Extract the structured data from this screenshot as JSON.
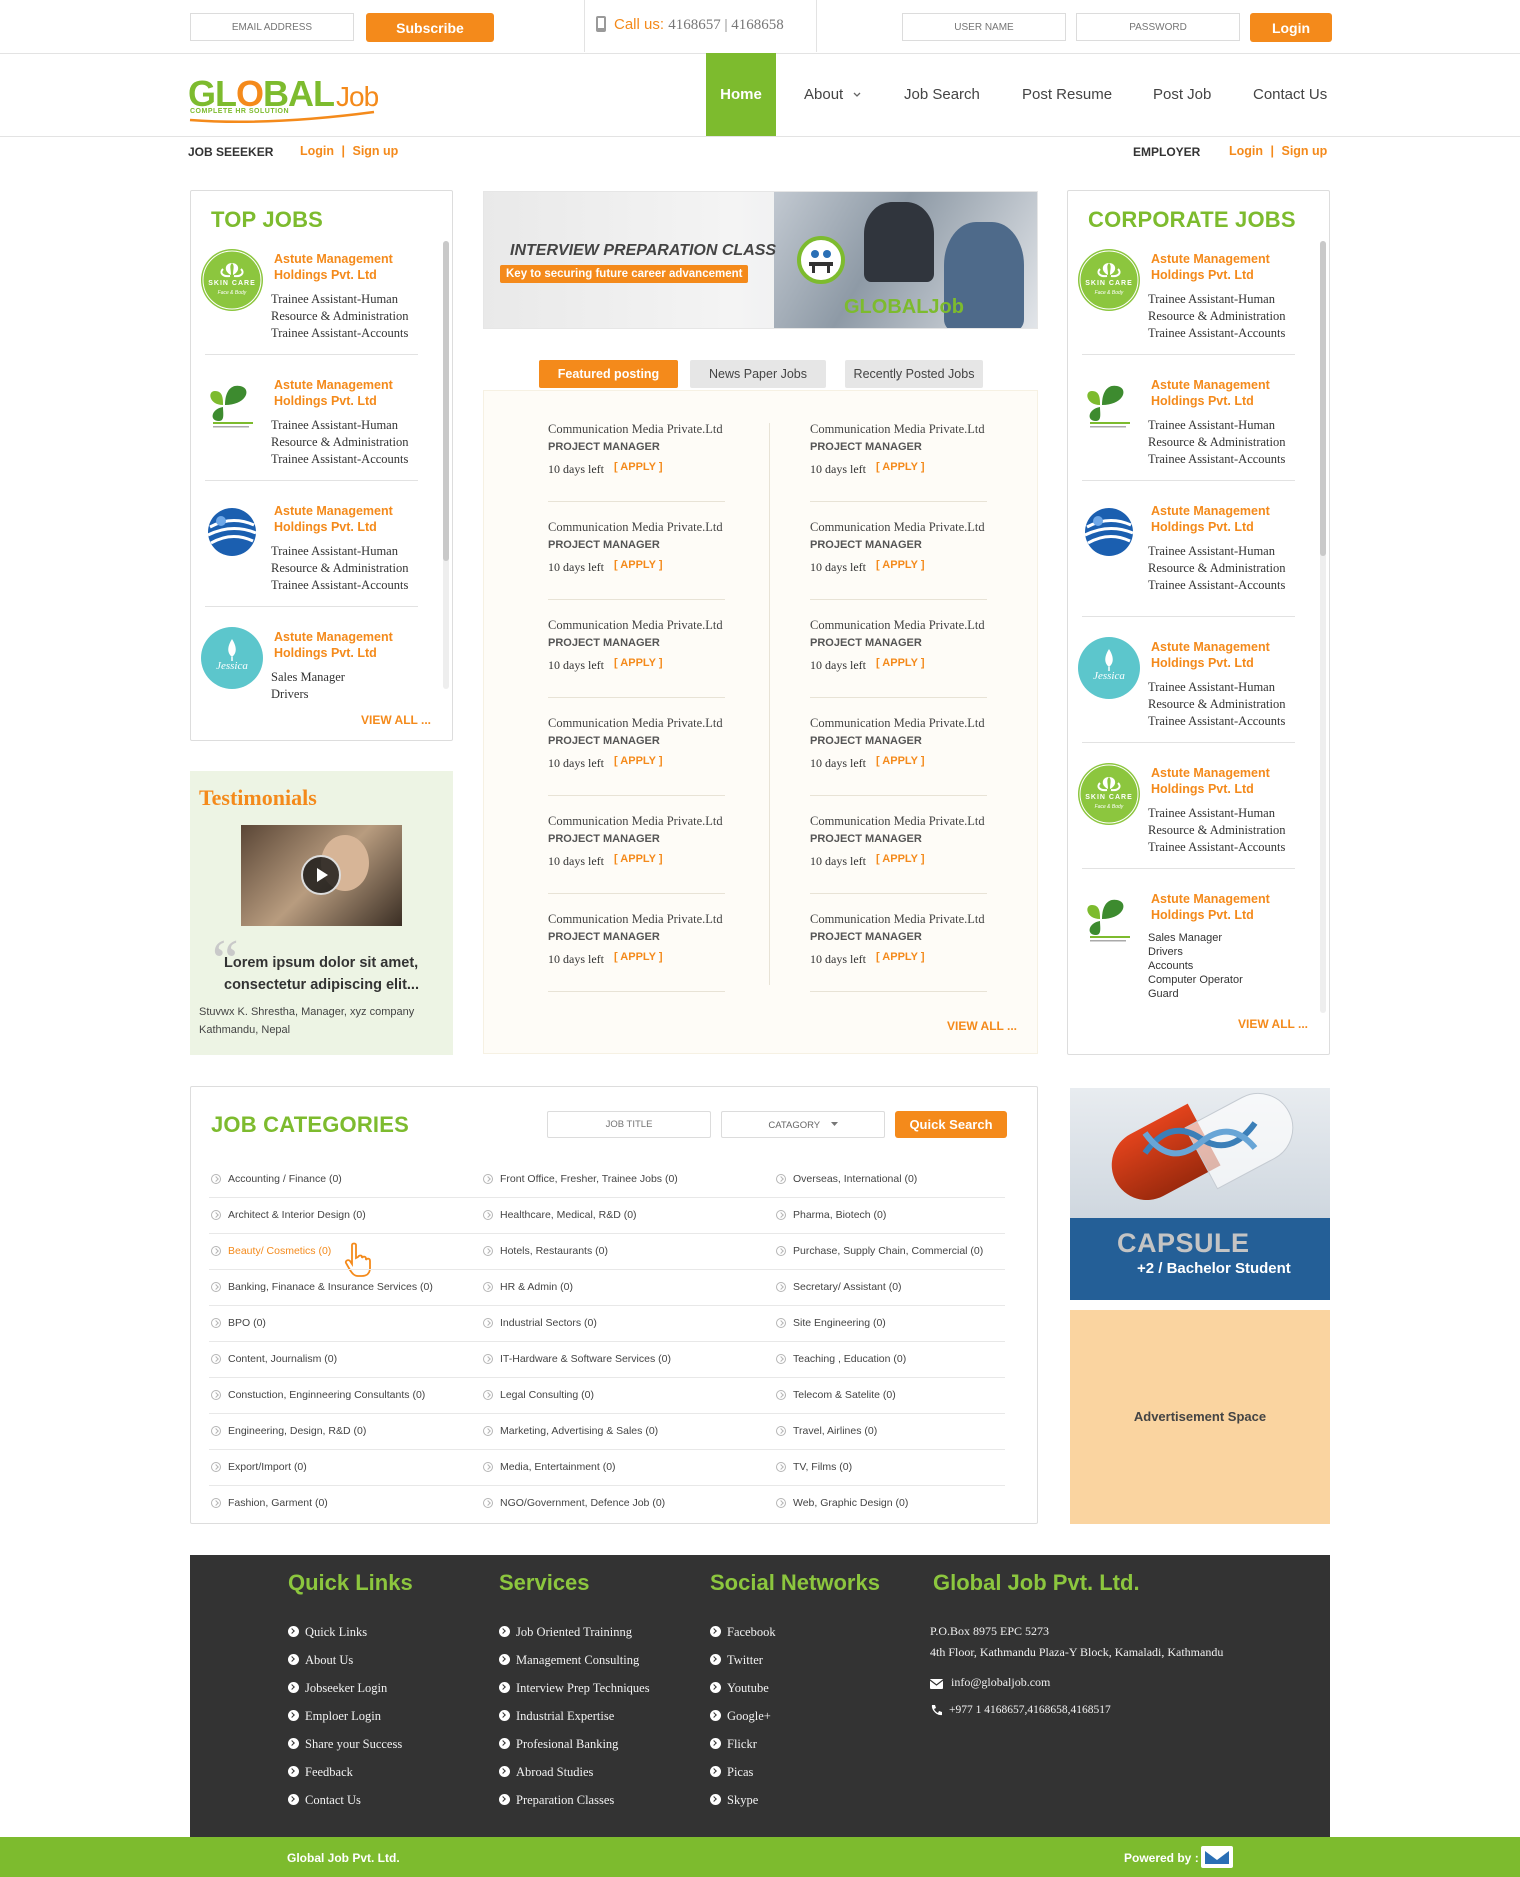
{
  "topbar": {
    "email_placeholder": "EMAIL ADDRESS",
    "subscribe_label": "Subscribe",
    "call_label": "Call us:",
    "call_numbers": "4168657 | 4168658",
    "username_placeholder": "USER NAME",
    "password_placeholder": "PASSWORD",
    "login_label": "Login"
  },
  "brand": {
    "logo_main": "GL",
    "logo_o": "O",
    "logo_rest": "BAL",
    "logo_job": "Job",
    "tagline": "COMPLETE HR SOLUTION"
  },
  "nav": {
    "home": "Home",
    "about": "About",
    "job_search": "Job Search",
    "post_resume": "Post Resume",
    "post_job": "Post Job",
    "contact_us": "Contact Us"
  },
  "subbar": {
    "seeker_label": "JOB SEEEKER",
    "seeker_login": "Login",
    "seeker_sep": "|",
    "seeker_signup": "Sign up",
    "employer_label": "EMPLOYER",
    "employer_login": "Login",
    "employer_sep": "|",
    "employer_signup": "Sign up"
  },
  "top_jobs": {
    "title": "TOP JOBS",
    "view_all": "VIEW ALL ...",
    "items": [
      {
        "company": "Astute Management Holdings Pvt. Ltd",
        "logo": "skincare-logo",
        "logo_text": "SKIN CARE",
        "logo_sub": "Face & Body",
        "lines": [
          "Trainee Assistant-Human Resource & Administration",
          "Trainee Assistant-Accounts"
        ]
      },
      {
        "company": "Astute Management Holdings Pvt. Ltd",
        "logo": "leaf-logo",
        "lines": [
          "Trainee Assistant-Human Resource & Administration",
          "Trainee Assistant-Accounts"
        ]
      },
      {
        "company": "Astute Management Holdings Pvt. Ltd",
        "logo": "globe-logo",
        "lines": [
          "Trainee Assistant-Human Resource & Administration",
          "Trainee Assistant-Accounts"
        ]
      },
      {
        "company": "Astute Management Holdings Pvt. Ltd",
        "logo": "jessica-logo",
        "logo_text": "Jessica",
        "lines": [
          "Sales Manager",
          "Drivers"
        ]
      }
    ]
  },
  "banner": {
    "title": "INTERVIEW PREPARATION CLASS",
    "subtitle": "Key to securing future career advancement",
    "logo_text": "GLOBALJob"
  },
  "tabs": {
    "featured": "Featured posting",
    "newspaper": "News Paper Jobs",
    "recent": "Recently Posted Jobs"
  },
  "featured": {
    "view_all": "VIEW ALL ...",
    "items": [
      {
        "company": "Communication Media Private.Ltd",
        "position": "PROJECT MANAGER",
        "days": "10 days left",
        "apply": "[ APPLY ]"
      },
      {
        "company": "Communication Media Private.Ltd",
        "position": "PROJECT MANAGER",
        "days": "10 days left",
        "apply": "[ APPLY ]"
      },
      {
        "company": "Communication Media Private.Ltd",
        "position": "PROJECT MANAGER",
        "days": "10 days left",
        "apply": "[ APPLY ]"
      },
      {
        "company": "Communication Media Private.Ltd",
        "position": "PROJECT MANAGER",
        "days": "10 days left",
        "apply": "[ APPLY ]"
      },
      {
        "company": "Communication Media Private.Ltd",
        "position": "PROJECT MANAGER",
        "days": "10 days left",
        "apply": "[ APPLY ]"
      },
      {
        "company": "Communication Media Private.Ltd",
        "position": "PROJECT MANAGER",
        "days": "10 days left",
        "apply": "[ APPLY ]"
      },
      {
        "company": "Communication Media Private.Ltd",
        "position": "PROJECT MANAGER",
        "days": "10 days left",
        "apply": "[ APPLY ]"
      },
      {
        "company": "Communication Media Private.Ltd",
        "position": "PROJECT MANAGER",
        "days": "10 days left",
        "apply": "[ APPLY ]"
      },
      {
        "company": "Communication Media Private.Ltd",
        "position": "PROJECT MANAGER",
        "days": "10 days left",
        "apply": "[ APPLY ]"
      },
      {
        "company": "Communication Media Private.Ltd",
        "position": "PROJECT MANAGER",
        "days": "10 days left",
        "apply": "[ APPLY ]"
      },
      {
        "company": "Communication Media Private.Ltd",
        "position": "PROJECT MANAGER",
        "days": "10 days left",
        "apply": "[ APPLY ]"
      },
      {
        "company": "Communication Media Private.Ltd",
        "position": "PROJECT MANAGER",
        "days": "10 days left",
        "apply": "[ APPLY ]"
      }
    ]
  },
  "corporate_jobs": {
    "title": "CORPORATE JOBS",
    "view_all": "VIEW ALL ...",
    "items": [
      {
        "company": "Astute Management Holdings Pvt. Ltd",
        "logo": "skincare-logo",
        "logo_text": "SKIN CARE",
        "logo_sub": "Face & Body",
        "lines": [
          "Trainee Assistant-Human Resource & Administration",
          "Trainee Assistant-Accounts"
        ]
      },
      {
        "company": "Astute Management Holdings Pvt. Ltd",
        "logo": "leaf-logo",
        "lines": [
          "Trainee Assistant-Human Resource & Administration",
          "Trainee Assistant-Accounts"
        ]
      },
      {
        "company": "Astute Management Holdings Pvt. Ltd",
        "logo": "globe-logo",
        "lines": [
          "Trainee Assistant-Human Resource & Administration",
          "Trainee Assistant-Accounts"
        ]
      },
      {
        "company": "Astute Management Holdings Pvt. Ltd",
        "logo": "jessica-logo",
        "logo_text": "Jessica",
        "lines": [
          "Trainee Assistant-Human Resource & Administration",
          "Trainee Assistant-Accounts"
        ]
      },
      {
        "company": "Astute Management Holdings Pvt. Ltd",
        "logo": "skincare-logo",
        "logo_text": "SKIN CARE",
        "logo_sub": "Face & Body",
        "lines": [
          "Trainee Assistant-Human Resource & Administration",
          "Trainee Assistant-Accounts"
        ]
      },
      {
        "company": "Astute Management Holdings Pvt. Ltd",
        "logo": "leaf-logo",
        "lines": [
          "Sales Manager",
          "Drivers",
          "Accounts",
          "Computer Operator",
          "Guard"
        ]
      }
    ]
  },
  "testimonials": {
    "title": "Testimonials",
    "quote": "Lorem ipsum dolor sit amet, consectetur adipiscing elit...",
    "author": "Stuvwx K. Shrestha, Manager, xyz company",
    "location": "Kathmandu, Nepal"
  },
  "categories": {
    "title": "JOB CATEGORIES",
    "job_title_placeholder": "JOB TITLE",
    "category_label": "CATAGORY",
    "quick_search": "Quick Search",
    "columns": [
      [
        "Accounting / Finance (0)",
        "Architect & Interior Design (0)",
        "Beauty/ Cosmetics (0)",
        "Banking, Finanace & Insurance Services (0)",
        "BPO (0)",
        "Content, Journalism (0)",
        "Constuction, Enginneering Consultants (0)",
        "Engineering, Design, R&D (0)",
        "Export/Import (0)",
        "Fashion, Garment (0)"
      ],
      [
        "Front Office, Fresher, Trainee Jobs (0)",
        "Healthcare, Medical, R&D (0)",
        "Hotels, Restaurants (0)",
        "HR & Admin (0)",
        "Industrial Sectors (0)",
        "IT-Hardware & Software Services (0)",
        "Legal Consulting (0)",
        "Marketing, Advertising & Sales (0)",
        "Media, Entertainment (0)",
        "NGO/Government, Defence Job (0)"
      ],
      [
        "Overseas, International (0)",
        "Pharma, Biotech (0)",
        "Purchase, Supply Chain, Commercial (0)",
        "Secretary/ Assistant (0)",
        "Site Engineering (0)",
        "Teaching , Education (0)",
        "Telecom & Satelite (0)",
        "Travel, Airlines (0)",
        "TV, Films (0)",
        "Web, Graphic Design (0)"
      ]
    ]
  },
  "ads": {
    "capsule_title": "CAPSULE",
    "capsule_sub": "+2 / Bachelor Student",
    "ad_space": "Advertisement Space"
  },
  "footer": {
    "quick_links_title": "Quick Links",
    "quick_links": [
      "Quick Links",
      "About Us",
      "Jobseeker Login",
      "Emploer Login",
      "Share your Success",
      "Feedback",
      "Contact Us"
    ],
    "services_title": "Services",
    "services": [
      "Job Oriented Traininng",
      "Management Consulting",
      "Interview Prep Techniques",
      "Industrial Expertise",
      "Profesional Banking",
      "Abroad Studies",
      "Preparation Classes"
    ],
    "social_title": "Social Networks",
    "social": [
      "Facebook",
      "Twitter",
      "Youtube",
      "Google+",
      "Flickr",
      "Picas",
      "Skype"
    ],
    "company_title": "Global Job Pvt. Ltd.",
    "address1": "P.O.Box 8975 EPC 5273",
    "address2": "4th Floor, Kathmandu Plaza-Y Block, Kamaladi, Kathmandu",
    "email": "info@globaljob.com",
    "phone": "+977 1 4168657,4168658,4168517",
    "bottom_left": "Global Job Pvt. Ltd.",
    "powered_by": "Powered by :"
  },
  "colors": {
    "brand_green": "#7dbb2e",
    "brand_orange": "#f48a1b",
    "footer_dark": "#333333",
    "capsule_blue": "#245f97",
    "ad_peach": "#fad4a0"
  }
}
